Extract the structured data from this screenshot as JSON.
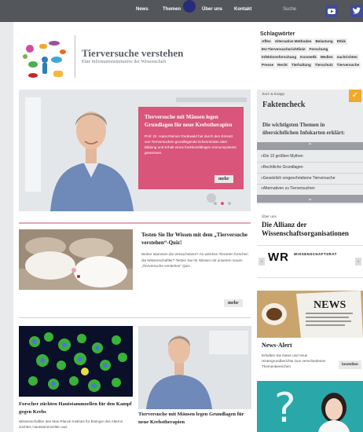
{
  "nav": {
    "items": [
      "News",
      "Themen",
      "Über uns",
      "Kontakt"
    ],
    "search_label": "Suche",
    "social": [
      "youtube-icon",
      "twitter-icon"
    ]
  },
  "brand": {
    "title": "Tierversuche verstehen",
    "subtitle": "Eine Informationsinitiative der Wissenschaft"
  },
  "schlagwoerter": {
    "heading": "Schlagwörter",
    "tags": [
      "Affen",
      "Alternative Methoden",
      "Belastung",
      "Ethik",
      "EU-Tierversuchsrichtlinie",
      "Forschung",
      "Infektionsforschung",
      "Kosmetik",
      "Medien",
      "nachrichten",
      "Presse",
      "Recht",
      "Tierhaltung",
      "Tierschutz",
      "Tierversuche"
    ]
  },
  "hero": {
    "title": "Tierversuche mit Mäusen legen Grundlagen für neue Krebstherapien",
    "text": "Prof. Dr. Hans-Reimer Rodewald hat durch den Einsatz von Tierversuchen grundlegende Erkenntnisse über Bildung und Erhalt eines funktionsfähigen Immunsystems gewonnen.",
    "more": "mehr"
  },
  "quiz": {
    "title": "Testen Sie Ihr Wissen mit dem „Tierversuche verstehen“-Quiz!",
    "text": "Woher stammen die Versuchstiere? An welchen Tierarten forschen die Wissenschaftler? Testen Sie Ihr Wissen mit unserem neuen „Tierversuche verstehen“ Quiz.",
    "more": "mehr"
  },
  "article_cells": {
    "title": "Forscher züchten Hautstammzellen für den Kampf gegen Krebs",
    "text": "Wissenschaftler des Max-Planck-Instituts für Biologie des Alterns züchten Hautstammzellen aus"
  },
  "article_mice": {
    "title": "Tierversuche mit Mäusen legen Grundlagen für neue Krebstherapien"
  },
  "faktencheck": {
    "kicker": "kurz & knapp",
    "title": "Faktencheck",
    "subtitle": "Die wichtigsten Themen in übersichtlichen Infokarten erklärt:",
    "items": [
      "»Die 10 größten Mythen",
      "»Rechtliche Grundlagen",
      "»Gesetzlich vorgeschriebene Tierversuche",
      "»Alternativen zu Tierversuchen"
    ]
  },
  "allianz": {
    "kicker": "Über uns",
    "title": "Die Allianz der Wissenschaftsorganisationen",
    "logo_text": "WR",
    "logo_sub": "WISSENSCHAFTSRAT"
  },
  "news_alert": {
    "image_text": "NEWS",
    "title": "News-Alert",
    "text": "Erhalten Sie News und neue Hintergrundberichte zum verschiedenen Themenbereichen",
    "button": "bestellen"
  },
  "colors": {
    "topbar": "#53565a",
    "accent_pink": "#d9557a",
    "accent_orange": "#f0a92a",
    "social_blue": "#3f4c98"
  }
}
